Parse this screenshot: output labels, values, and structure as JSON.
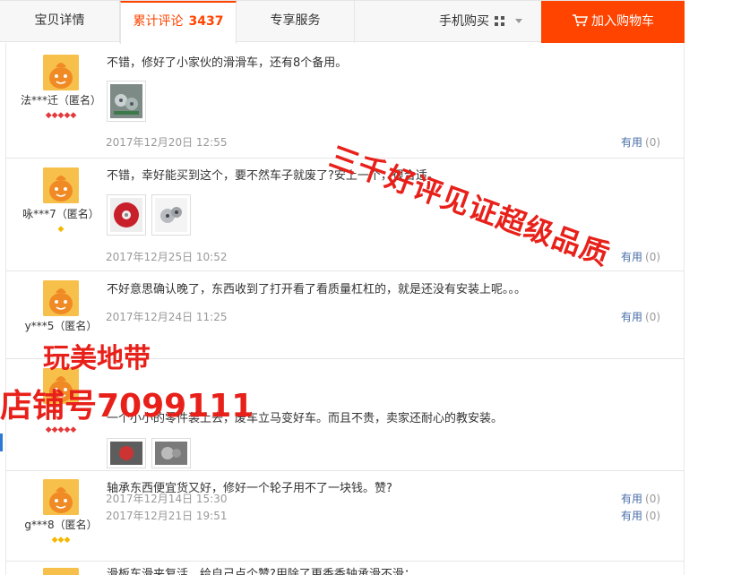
{
  "tabs": {
    "details": "宝贝详情",
    "reviews_label": "累计评论",
    "reviews_count": "3437",
    "service": "专享服务"
  },
  "header": {
    "mobile_buy": "手机购买",
    "add_to_cart": "加入购物车"
  },
  "reviews": [
    {
      "user": "法***迁（匿名）",
      "rank": "◆◆◆◆◆",
      "rank_color": "#e4393c",
      "content": "不错，修好了小家伙的滑滑车，还有8个备用。",
      "date": "2017年12月20日 12:55",
      "useful_label": "有用",
      "useful_count": "(0)"
    },
    {
      "user": "咏***7（匿名）",
      "rank": "◆",
      "rank_color": "#f5b800",
      "content": "不错，幸好能买到这个，要不然车子就废了?安上一个，很合适。",
      "date": "2017年12月25日 10:52",
      "useful_label": "有用",
      "useful_count": "(0)"
    },
    {
      "user": "y***5（匿名）",
      "rank": "",
      "rank_color": "#f5b800",
      "content": "不好意思确认晚了，东西收到了打开看了看质量杠杠的，就是还没有安装上呢。。。",
      "date": "2017年12月24日 11:25",
      "useful_label": "有用",
      "useful_count": "(0)"
    },
    {
      "user": "",
      "rank": "◆◆◆◆◆",
      "rank_color": "#e4393c",
      "content": "一个小小的零件装上去，废车立马变好车。而且不贵，卖家还耐心的教安装。",
      "date": "2017年12月14日 15:30",
      "useful_label": "有用",
      "useful_count": "(0)"
    },
    {
      "user": "g***8（匿名）",
      "rank": "◆◆◆",
      "rank_color": "#f5b800",
      "content": "轴承东西便宜货又好，修好一个轮子用不了一块钱。赞?",
      "date": "2017年12月21日 19:51",
      "useful_label": "有用",
      "useful_count": "(0)"
    },
    {
      "user": "",
      "rank": "",
      "rank_color": "#e4393c",
      "content": "滑板车滑夹复活，给自己点个赞?用除了更香香轴承滑不滑：",
      "date": "",
      "useful_label": "",
      "useful_count": ""
    }
  ],
  "watermarks": {
    "diagonal": "三千好评见证超级品质",
    "store_line1": "玩美地带",
    "store_line2": "店铺号7099111"
  },
  "colors": {
    "accent": "#ff4400",
    "link": "#4a6ea8",
    "watermark": "#e8201a"
  },
  "icons": {
    "qr": "qr-code-icon",
    "cart": "shopping-cart-icon",
    "avatar": "default-avatar-icon"
  }
}
